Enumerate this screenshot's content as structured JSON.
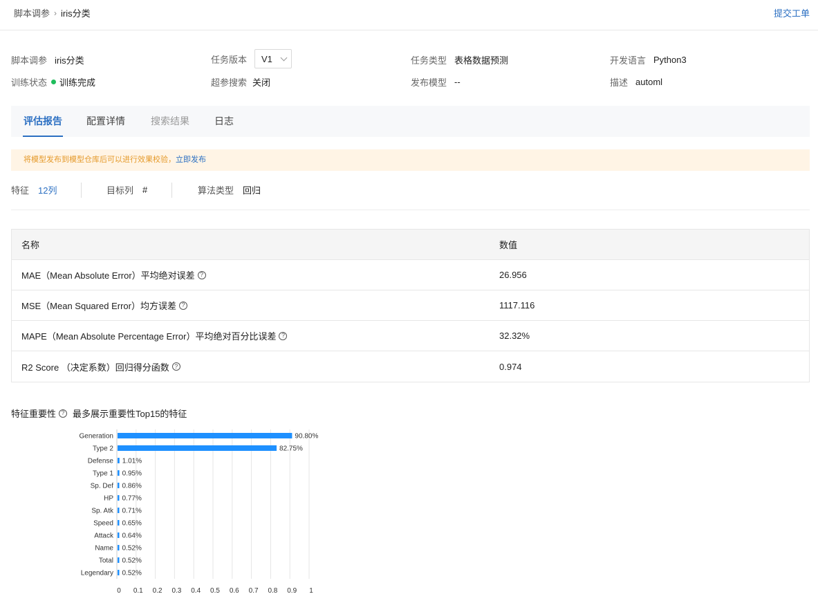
{
  "breadcrumb": {
    "root": "脚本调参",
    "current": "iris分类"
  },
  "submit_ticket": "提交工单",
  "info": {
    "script": {
      "label": "脚本调参",
      "value": "iris分类"
    },
    "version": {
      "label": "任务版本",
      "value": "V1"
    },
    "task_type": {
      "label": "任务类型",
      "value": "表格数据预测"
    },
    "language": {
      "label": "开发语言",
      "value": "Python3"
    },
    "train_status": {
      "label": "训练状态",
      "value": "训练完成"
    },
    "hp_search": {
      "label": "超参搜索",
      "value": "关闭"
    },
    "publish_model": {
      "label": "发布模型",
      "value": "--"
    },
    "desc": {
      "label": "描述",
      "value": "automl"
    }
  },
  "tabs": [
    {
      "label": "评估报告",
      "state": "active"
    },
    {
      "label": "配置详情",
      "state": "normal"
    },
    {
      "label": "搜索结果",
      "state": "disabled"
    },
    {
      "label": "日志",
      "state": "normal"
    }
  ],
  "notice": {
    "text": "将模型发布到模型仓库后可以进行效果校验，",
    "link": "立即发布"
  },
  "meta": {
    "features": {
      "label": "特征",
      "value": "12列"
    },
    "target": {
      "label": "目标列",
      "value": "#"
    },
    "algo": {
      "label": "算法类型",
      "value": "回归"
    }
  },
  "metrics": {
    "header": {
      "name": "名称",
      "value": "数值"
    },
    "rows": [
      {
        "name": "MAE（Mean Absolute Error）平均绝对误差",
        "value": "26.956"
      },
      {
        "name": "MSE（Mean Squared Error）均方误差",
        "value": "1117.116"
      },
      {
        "name": "MAPE（Mean Absolute Percentage Error）平均绝对百分比误差",
        "value": "32.32%"
      },
      {
        "name": "R2 Score （决定系数）回归得分函数",
        "value": "0.974"
      }
    ]
  },
  "feature_importance": {
    "title": "特征重要性",
    "subtitle": "最多展示重要性Top15的特征"
  },
  "colors": {
    "accent": "#2b6fc2",
    "bar": "#1e90ff",
    "success": "#1fbd5c",
    "notice_bg": "#fff4e5",
    "notice_text": "#e59a2b"
  },
  "chart_data": {
    "type": "bar",
    "orientation": "horizontal",
    "categories": [
      "Generation",
      "Type 2",
      "Defense",
      "Type 1",
      "Sp. Def",
      "HP",
      "Sp. Atk",
      "Speed",
      "Attack",
      "Name",
      "Total",
      "Legendary"
    ],
    "values": [
      0.908,
      0.8275,
      0.0101,
      0.0095,
      0.0086,
      0.0077,
      0.0071,
      0.0065,
      0.0064,
      0.0052,
      0.0052,
      0.0052
    ],
    "labels": [
      "90.80%",
      "82.75%",
      "1.01%",
      "0.95%",
      "0.86%",
      "0.77%",
      "0.71%",
      "0.65%",
      "0.64%",
      "0.52%",
      "0.52%",
      "0.52%"
    ],
    "xticks": [
      "0",
      "0.1",
      "0.2",
      "0.3",
      "0.4",
      "0.5",
      "0.6",
      "0.7",
      "0.8",
      "0.9",
      "1"
    ],
    "xlim": [
      0,
      1
    ],
    "grid": true
  }
}
